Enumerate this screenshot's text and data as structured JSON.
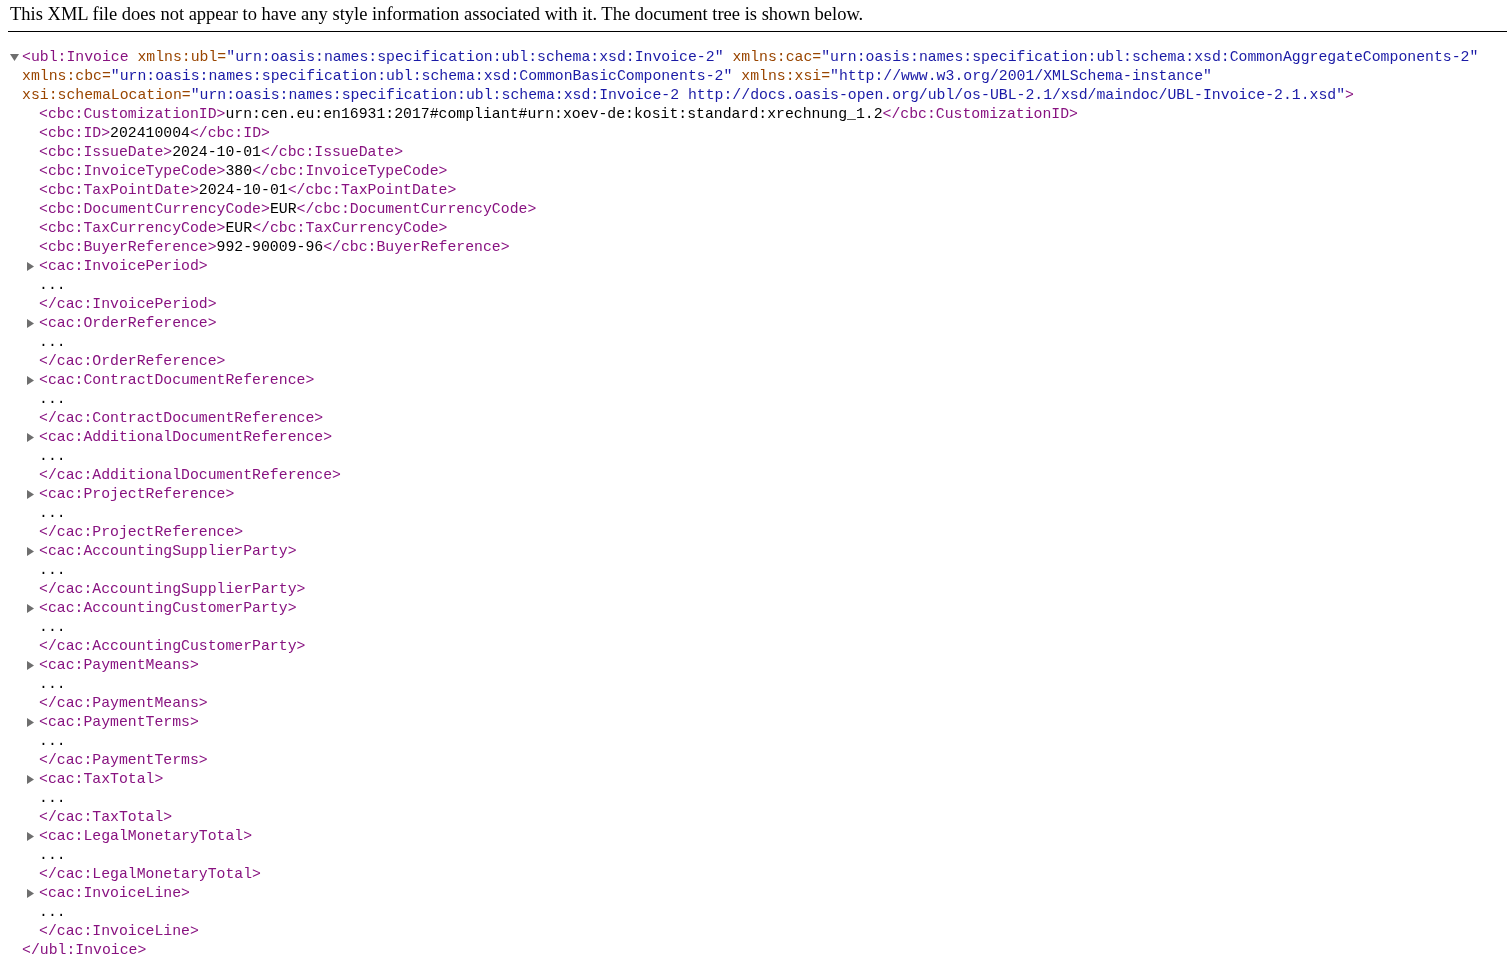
{
  "notice": "This XML file does not appear to have any style information associated with it. The document tree is shown below.",
  "root": {
    "expanded": true,
    "open": "<ubl:Invoice",
    "attributes": [
      "xmlns:ubl=\"urn:oasis:names:specification:ubl:schema:xsd:Invoice-2\"",
      "xmlns:cac=\"urn:oasis:names:specification:ubl:schema:xsd:CommonAggregateComponents-2\"",
      "xmlns:cbc=\"urn:oasis:names:specification:ubl:schema:xsd:CommonBasicComponents-2\"",
      "xmlns:xsi=\"http://www.w3.org/2001/XMLSchema-instance\"",
      "xsi:schemaLocation=\"urn:oasis:names:specification:ubl:schema:xsd:Invoice-2 http://docs.oasis-open.org/ubl/os-UBL-2.1/xsd/maindoc/UBL-Invoice-2.1.xsd\""
    ],
    "open_end": ">",
    "close": "</ubl:Invoice>",
    "children": [
      {
        "kind": "leaf",
        "open": "<cbc:CustomizationID>",
        "text": "urn:cen.eu:en16931:2017#compliant#urn:xoev-de:kosit:standard:xrechnung_1.2",
        "close": "</cbc:CustomizationID>"
      },
      {
        "kind": "leaf",
        "open": "<cbc:ID>",
        "text": "202410004",
        "close": "</cbc:ID>"
      },
      {
        "kind": "leaf",
        "open": "<cbc:IssueDate>",
        "text": "2024-10-01",
        "close": "</cbc:IssueDate>"
      },
      {
        "kind": "leaf",
        "open": "<cbc:InvoiceTypeCode>",
        "text": "380",
        "close": "</cbc:InvoiceTypeCode>"
      },
      {
        "kind": "leaf",
        "open": "<cbc:TaxPointDate>",
        "text": "2024-10-01",
        "close": "</cbc:TaxPointDate>"
      },
      {
        "kind": "leaf",
        "open": "<cbc:DocumentCurrencyCode>",
        "text": "EUR",
        "close": "</cbc:DocumentCurrencyCode>"
      },
      {
        "kind": "leaf",
        "open": "<cbc:TaxCurrencyCode>",
        "text": "EUR",
        "close": "</cbc:TaxCurrencyCode>"
      },
      {
        "kind": "leaf",
        "open": "<cbc:BuyerReference>",
        "text": "992-90009-96",
        "close": "</cbc:BuyerReference>"
      },
      {
        "kind": "element",
        "expanded": false,
        "open": "<cac:InvoicePeriod>",
        "content": "...",
        "close": "</cac:InvoicePeriod>"
      },
      {
        "kind": "element",
        "expanded": false,
        "open": "<cac:OrderReference>",
        "content": "...",
        "close": "</cac:OrderReference>"
      },
      {
        "kind": "element",
        "expanded": false,
        "open": "<cac:ContractDocumentReference>",
        "content": "...",
        "close": "</cac:ContractDocumentReference>"
      },
      {
        "kind": "element",
        "expanded": false,
        "open": "<cac:AdditionalDocumentReference>",
        "content": "...",
        "close": "</cac:AdditionalDocumentReference>"
      },
      {
        "kind": "element",
        "expanded": false,
        "open": "<cac:ProjectReference>",
        "content": "...",
        "close": "</cac:ProjectReference>"
      },
      {
        "kind": "element",
        "expanded": false,
        "open": "<cac:AccountingSupplierParty>",
        "content": "...",
        "close": "</cac:AccountingSupplierParty>"
      },
      {
        "kind": "element",
        "expanded": false,
        "open": "<cac:AccountingCustomerParty>",
        "content": "...",
        "close": "</cac:AccountingCustomerParty>"
      },
      {
        "kind": "element",
        "expanded": false,
        "open": "<cac:PaymentMeans>",
        "content": "...",
        "close": "</cac:PaymentMeans>"
      },
      {
        "kind": "element",
        "expanded": false,
        "open": "<cac:PaymentTerms>",
        "content": "...",
        "close": "</cac:PaymentTerms>"
      },
      {
        "kind": "element",
        "expanded": false,
        "open": "<cac:TaxTotal>",
        "content": "...",
        "close": "</cac:TaxTotal>"
      },
      {
        "kind": "element",
        "expanded": false,
        "open": "<cac:LegalMonetaryTotal>",
        "content": "...",
        "close": "</cac:LegalMonetaryTotal>"
      },
      {
        "kind": "element",
        "expanded": false,
        "open": "<cac:InvoiceLine>",
        "content": "...",
        "close": "</cac:InvoiceLine>"
      }
    ]
  }
}
